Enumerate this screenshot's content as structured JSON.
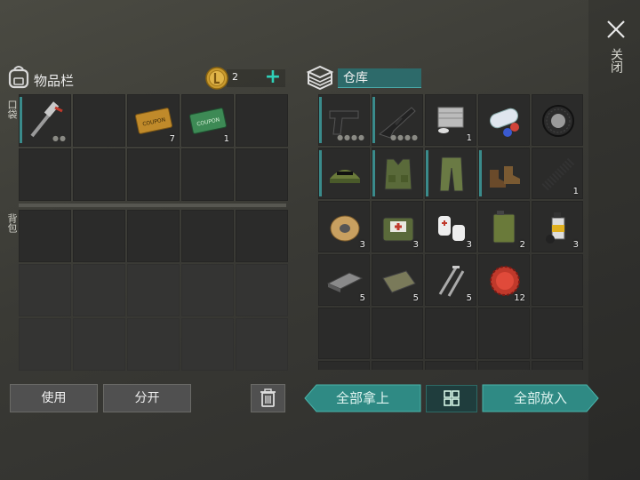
{
  "close": {
    "label": "关闭"
  },
  "inventory": {
    "title": "物品栏",
    "coins": "2",
    "pocket_label": "口袋",
    "backpack_label": "背包",
    "slots": [
      {
        "item": "hammer",
        "qty": "",
        "bar": true,
        "dots": "●●"
      },
      {
        "item": "",
        "qty": ""
      },
      {
        "item": "gold-coupon",
        "qty": "7"
      },
      {
        "item": "green-coupon",
        "qty": "1"
      },
      {
        "item": "",
        "qty": ""
      },
      {
        "item": "",
        "qty": ""
      },
      {
        "item": "",
        "qty": ""
      },
      {
        "item": "",
        "qty": ""
      },
      {
        "item": "",
        "qty": ""
      },
      {
        "item": "",
        "qty": ""
      }
    ],
    "backpack_slots": 15
  },
  "storage": {
    "title": "仓库",
    "slots": [
      {
        "item": "pistol",
        "qty": "",
        "bar": true,
        "dots": "●●●●"
      },
      {
        "item": "rifle",
        "qty": "",
        "bar": true,
        "dots": "●●●●"
      },
      {
        "item": "engine",
        "qty": "1"
      },
      {
        "item": "paper-roll",
        "qty": ""
      },
      {
        "item": "tire",
        "qty": ""
      },
      {
        "item": "military-cap",
        "qty": "",
        "bar": true
      },
      {
        "item": "tactical-vest",
        "qty": "",
        "bar": true
      },
      {
        "item": "camo-pants",
        "qty": "",
        "bar": true
      },
      {
        "item": "boots",
        "qty": "",
        "bar": true
      },
      {
        "item": "spring",
        "qty": "1"
      },
      {
        "item": "wire-spool",
        "qty": "3"
      },
      {
        "item": "medkit",
        "qty": "3"
      },
      {
        "item": "bandages",
        "qty": "3"
      },
      {
        "item": "jerrycan",
        "qty": "2"
      },
      {
        "item": "spray-can",
        "qty": "3"
      },
      {
        "item": "metal-bar",
        "qty": "5"
      },
      {
        "item": "cloth",
        "qty": "5"
      },
      {
        "item": "nails",
        "qty": "5"
      },
      {
        "item": "bottle-cap",
        "qty": "12"
      },
      {
        "item": "",
        "qty": ""
      },
      {
        "item": "",
        "qty": ""
      },
      {
        "item": "",
        "qty": ""
      },
      {
        "item": "",
        "qty": ""
      },
      {
        "item": "",
        "qty": ""
      },
      {
        "item": "",
        "qty": ""
      },
      {
        "item": "",
        "qty": ""
      },
      {
        "item": "",
        "qty": ""
      },
      {
        "item": "",
        "qty": ""
      },
      {
        "item": "",
        "qty": ""
      },
      {
        "item": "",
        "qty": ""
      }
    ]
  },
  "buttons": {
    "use": "使用",
    "split": "分开",
    "take_all": "全部拿上",
    "put_all": "全部放入"
  },
  "colors": {
    "accent": "#2fd0b8",
    "teal_button": "#2f8a84",
    "panel": "#2b2b2a"
  }
}
